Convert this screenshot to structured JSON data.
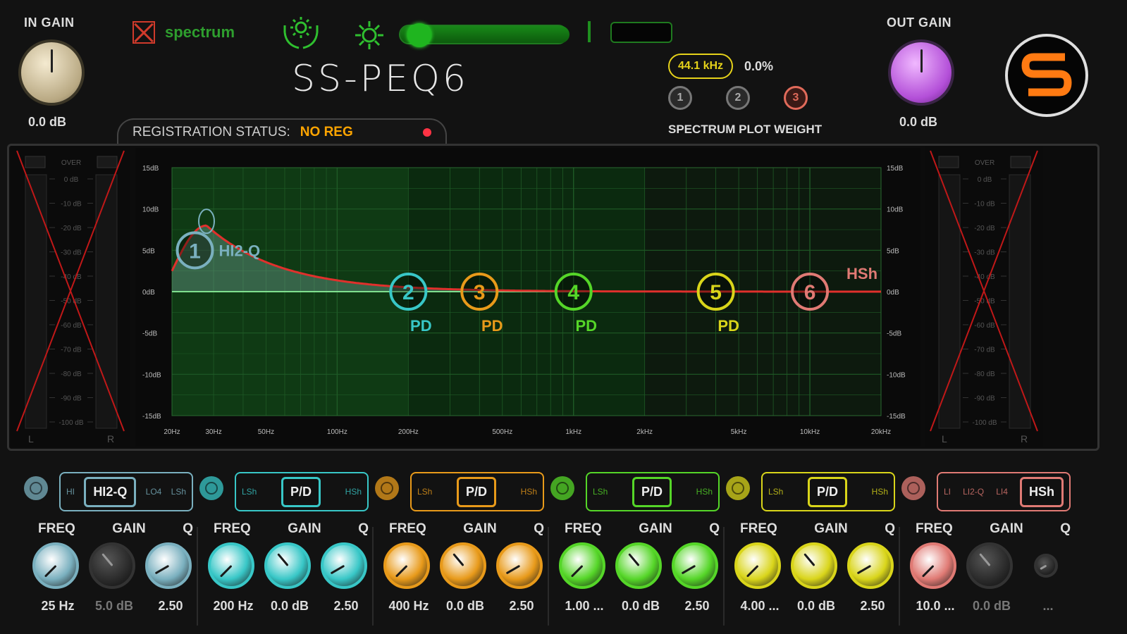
{
  "header": {
    "in_gain": {
      "label": "IN GAIN",
      "value": "0.0 dB"
    },
    "out_gain": {
      "label": "OUT GAIN",
      "value": "0.0 dB"
    },
    "spectrum_toggle": {
      "label": "spectrum",
      "enabled": false
    },
    "title": "SS-PEQ6",
    "sample_rate": "44.1 kHz",
    "cpu_percent": "0.0%",
    "spectrum_weight": {
      "label": "SPECTRUM PLOT WEIGHT",
      "buttons": [
        "1",
        "2",
        "3"
      ]
    },
    "brightness_slider": {
      "fraction": 0.05
    },
    "registration": {
      "label": "REGISTRATION STATUS:",
      "status": "NO REG"
    }
  },
  "meters": {
    "over_label": "OVER",
    "scale": [
      "0 dB",
      "-10 dB",
      "-20 dB",
      "-30 dB",
      "-40 dB",
      "-50 dB",
      "-60 dB",
      "-70 dB",
      "-80 dB",
      "-90 dB",
      "-100 dB"
    ],
    "channels": [
      "L",
      "R"
    ]
  },
  "graph": {
    "y_ticks": [
      "15dB",
      "10dB",
      "5dB",
      "0dB",
      "-5dB",
      "-10dB",
      "-15dB"
    ],
    "x_ticks": [
      "20Hz",
      "30Hz",
      "50Hz",
      "100Hz",
      "200Hz",
      "500Hz",
      "1kHz",
      "2kHz",
      "5kHz",
      "10kHz",
      "20kHz"
    ],
    "nodes": [
      {
        "num": "1",
        "type": "HI2-Q",
        "freq_hz": 25,
        "gain_db": 5.0,
        "color": "#7ab0bf"
      },
      {
        "num": "2",
        "type": "PD",
        "freq_hz": 200,
        "gain_db": 0,
        "color": "#38c7c7"
      },
      {
        "num": "3",
        "type": "PD",
        "freq_hz": 400,
        "gain_db": 0,
        "color": "#e89a1a"
      },
      {
        "num": "4",
        "type": "PD",
        "freq_hz": 1000,
        "gain_db": 0,
        "color": "#55d628"
      },
      {
        "num": "5",
        "type": "PD",
        "freq_hz": 4000,
        "gain_db": 0,
        "color": "#d9d51a"
      },
      {
        "num": "6",
        "type": "HSh",
        "freq_hz": 10000,
        "gain_db": 0,
        "color": "#e07a74"
      }
    ]
  },
  "bands": [
    {
      "color": "#7ab0bf",
      "options": [
        "HI",
        "HI2-Q",
        "LO4",
        "LSh"
      ],
      "selected": 1,
      "labels": [
        "FREQ",
        "GAIN",
        "Q"
      ],
      "values": [
        "25 Hz",
        "5.0 dB",
        "2.50"
      ],
      "dim": [
        false,
        true,
        false
      ]
    },
    {
      "color": "#38c7c7",
      "options": [
        "LSh",
        "P/D",
        "HSh"
      ],
      "selected": 1,
      "labels": [
        "FREQ",
        "GAIN",
        "Q"
      ],
      "values": [
        "200 Hz",
        "0.0 dB",
        "2.50"
      ],
      "dim": [
        false,
        false,
        false
      ]
    },
    {
      "color": "#e89a1a",
      "options": [
        "LSh",
        "P/D",
        "HSh"
      ],
      "selected": 1,
      "labels": [
        "FREQ",
        "GAIN",
        "Q"
      ],
      "values": [
        "400 Hz",
        "0.0 dB",
        "2.50"
      ],
      "dim": [
        false,
        false,
        false
      ]
    },
    {
      "color": "#55d628",
      "options": [
        "LSh",
        "P/D",
        "HSh"
      ],
      "selected": 1,
      "labels": [
        "FREQ",
        "GAIN",
        "Q"
      ],
      "values": [
        "1.00 ...",
        "0.0 dB",
        "2.50"
      ],
      "dim": [
        false,
        false,
        false
      ]
    },
    {
      "color": "#d9d51a",
      "options": [
        "LSh",
        "P/D",
        "HSh"
      ],
      "selected": 1,
      "labels": [
        "FREQ",
        "GAIN",
        "Q"
      ],
      "values": [
        "4.00 ...",
        "0.0 dB",
        "2.50"
      ],
      "dim": [
        false,
        false,
        false
      ]
    },
    {
      "color": "#e07a74",
      "options": [
        "LI",
        "LI2-Q",
        "LI4",
        "HSh"
      ],
      "selected": 3,
      "labels": [
        "FREQ",
        "GAIN",
        "Q"
      ],
      "values": [
        "10.0 ...",
        "0.0 dB",
        "..."
      ],
      "dim": [
        false,
        true,
        true
      ]
    }
  ]
}
